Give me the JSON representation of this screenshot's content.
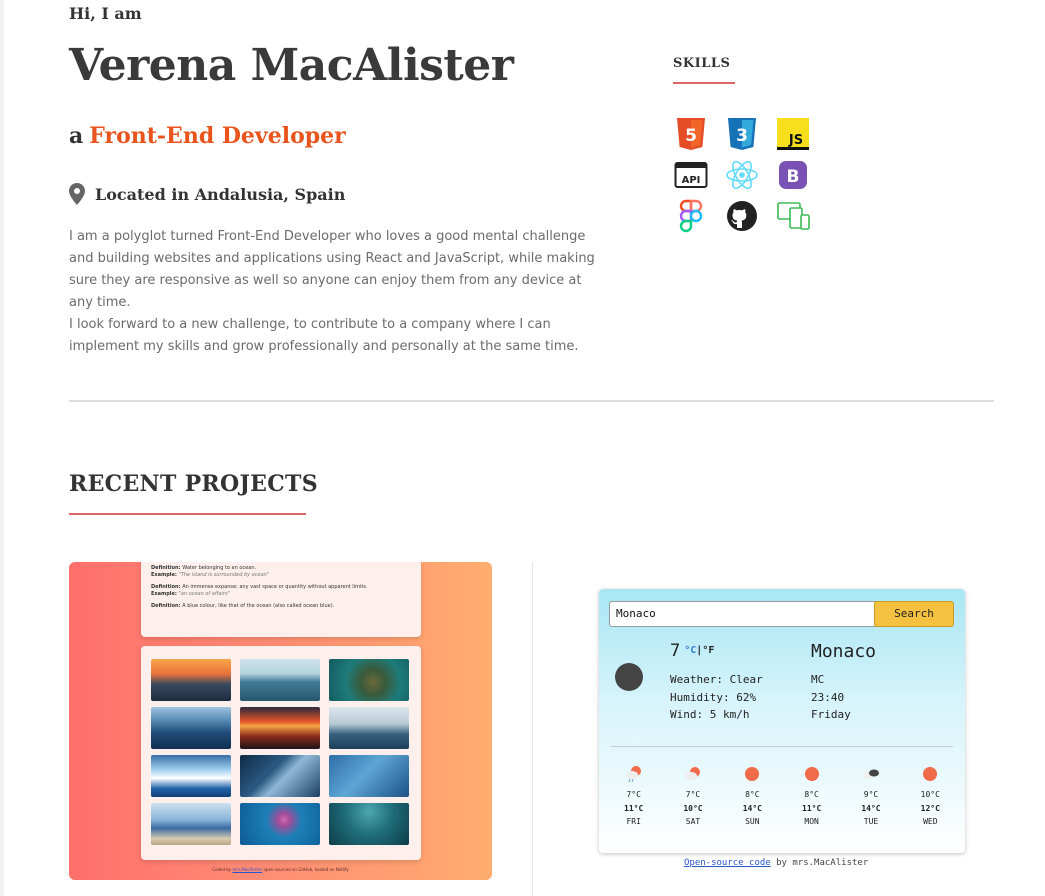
{
  "hero": {
    "greeting": "Hi, I am",
    "name": "Verena MacAlister",
    "role_prefix": "a",
    "role": "Front-End Developer",
    "location": "Located in Andalusia, Spain",
    "bio_line1": "I am a polyglot turned Front-End Developer who loves a good mental challenge and building websites and applications using React and JavaScript, while making sure they are responsive as well so anyone can enjoy them from any device at any time.",
    "bio_line2": "I look forward to a new challenge, to contribute to a company where I can implement my skills and grow professionally and personally at the same time."
  },
  "skills": {
    "title": "SKILLS",
    "items": [
      {
        "icon": "html5-icon",
        "text": "5"
      },
      {
        "icon": "css3-icon",
        "text": "3"
      },
      {
        "icon": "javascript-icon",
        "text": "JS"
      },
      {
        "icon": "api-icon",
        "text": "API"
      },
      {
        "icon": "react-icon",
        "text": ""
      },
      {
        "icon": "bootstrap-icon",
        "text": "B"
      },
      {
        "icon": "figma-icon",
        "text": ""
      },
      {
        "icon": "github-icon",
        "text": ""
      },
      {
        "icon": "responsive-devices-icon",
        "text": ""
      }
    ]
  },
  "projects": {
    "title": "RECENT PROJECTS",
    "dictionary": {
      "definitions": [
        {
          "label": "Definition:",
          "text": "Water belonging to an ocean.",
          "example_label": "Example:",
          "example": "\"The island is surrounded by ocean\""
        },
        {
          "label": "Definition:",
          "text": "An immense expanse; any vast space or quantity without apparent limits.",
          "example_label": "Example:",
          "example": "\"an ocean of affairs\""
        },
        {
          "label": "Definition:",
          "text": "A blue colour, like that of the ocean (also called ocean blue).",
          "example_label": "",
          "example": ""
        }
      ],
      "footer_prefix": "Coded by",
      "footer_link": "mrs.MacAlister",
      "footer_suffix": "open-sourced on GitHub, hosted on Netlify"
    },
    "weather": {
      "search_value": "Monaco",
      "search_button": "Search",
      "temp": "7",
      "unit_c": "°C",
      "unit_sep": "|",
      "unit_f": "°F",
      "weather": "Weather: Clear",
      "humidity": "Humidity: 62%",
      "wind": "Wind: 5 km/h",
      "city": "Monaco",
      "country": "MC",
      "time": "23:40",
      "weekday": "Friday",
      "forecast": [
        {
          "icon": "rain-icon",
          "low": "7°C",
          "high": "11°C",
          "day": "FRI"
        },
        {
          "icon": "partly-cloudy-icon",
          "low": "7°C",
          "high": "10°C",
          "day": "SAT"
        },
        {
          "icon": "sun-icon",
          "low": "8°C",
          "high": "14°C",
          "day": "SUN"
        },
        {
          "icon": "sun-icon",
          "low": "8°C",
          "high": "11°C",
          "day": "MON"
        },
        {
          "icon": "cloudy-icon",
          "low": "9°C",
          "high": "14°C",
          "day": "TUE"
        },
        {
          "icon": "sun-icon",
          "low": "10°C",
          "high": "12°C",
          "day": "WED"
        }
      ],
      "caption_link": "Open-source code",
      "caption_suffix": "by mrs.MacAlister"
    }
  },
  "colors": {
    "accent": "#e8541c",
    "underline": "#e06666",
    "search_button": "#f5c141"
  }
}
